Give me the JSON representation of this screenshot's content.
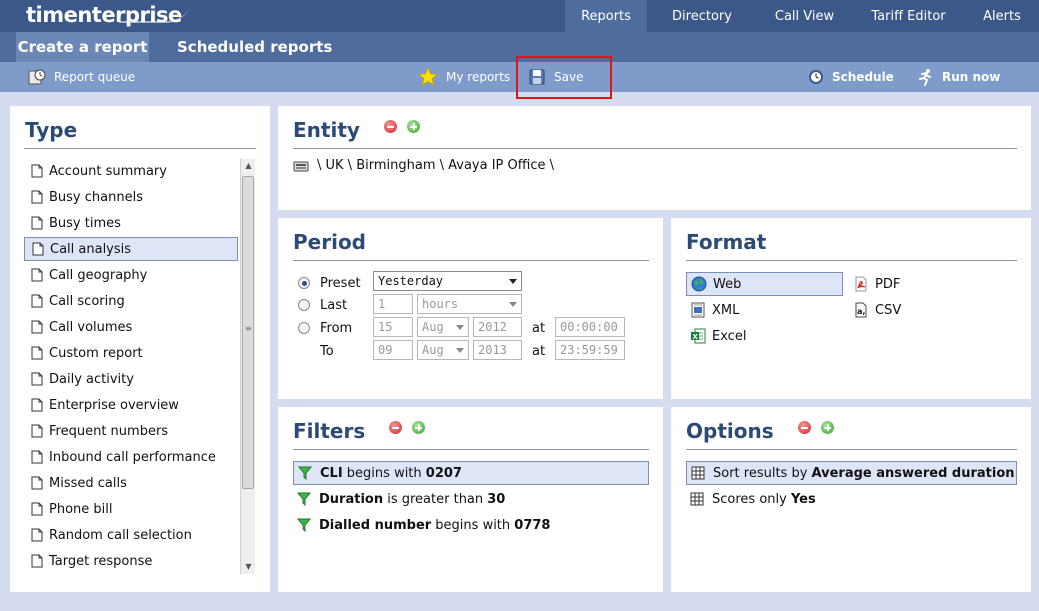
{
  "header": {
    "logo": "timenterprise",
    "nav": [
      "Reports",
      "Directory",
      "Call View",
      "Tariff Editor",
      "Alerts"
    ]
  },
  "subnav": {
    "create": "Create a report",
    "scheduled": "Scheduled reports"
  },
  "toolbar": {
    "queue": "Report queue",
    "my_reports": "My reports",
    "save": "Save",
    "schedule": "Schedule",
    "run_now": "Run now"
  },
  "type": {
    "title": "Type",
    "items": [
      "Account summary",
      "Busy channels",
      "Busy times",
      "Call analysis",
      "Call geography",
      "Call scoring",
      "Call volumes",
      "Custom report",
      "Daily activity",
      "Enterprise overview",
      "Frequent numbers",
      "Inbound call performance",
      "Missed calls",
      "Phone bill",
      "Random call selection",
      "Target response"
    ],
    "selected": "Call analysis"
  },
  "entity": {
    "title": "Entity",
    "path": "\\ UK \\ Birmingham \\ Avaya IP Office \\"
  },
  "period": {
    "title": "Period",
    "preset_label": "Preset",
    "preset_value": "Yesterday",
    "last_label": "Last",
    "last_count": "1",
    "last_unit": "hours",
    "from_label": "From",
    "to_label": "To",
    "from": {
      "day": "15",
      "month": "Aug",
      "year": "2012",
      "time": "00:00:00"
    },
    "to": {
      "day": "09",
      "month": "Aug",
      "year": "2013",
      "time": "23:59:59"
    },
    "at": "at",
    "selected": "Preset"
  },
  "format": {
    "title": "Format",
    "web": "Web",
    "xml": "XML",
    "excel": "Excel",
    "pdf": "PDF",
    "csv": "CSV",
    "selected": "Web"
  },
  "filters": {
    "title": "Filters",
    "rows": [
      {
        "field": "CLI",
        "op": " begins with ",
        "value": "0207"
      },
      {
        "field": "Duration",
        "op": " is greater than ",
        "value": "30"
      },
      {
        "field": "Dialled number",
        "op": " begins with ",
        "value": "0778"
      }
    ]
  },
  "options": {
    "title": "Options",
    "rows": [
      {
        "text": "Sort results by ",
        "value": "Average answered duration"
      },
      {
        "text": "Scores only ",
        "value": "Yes"
      }
    ]
  },
  "colors": {
    "header": "#3b5888",
    "subnav": "#4e6d9d",
    "toolbar": "#7e9bca",
    "background": "#d5dcef",
    "title": "#2c4a76",
    "highlight": "#e0121a"
  }
}
